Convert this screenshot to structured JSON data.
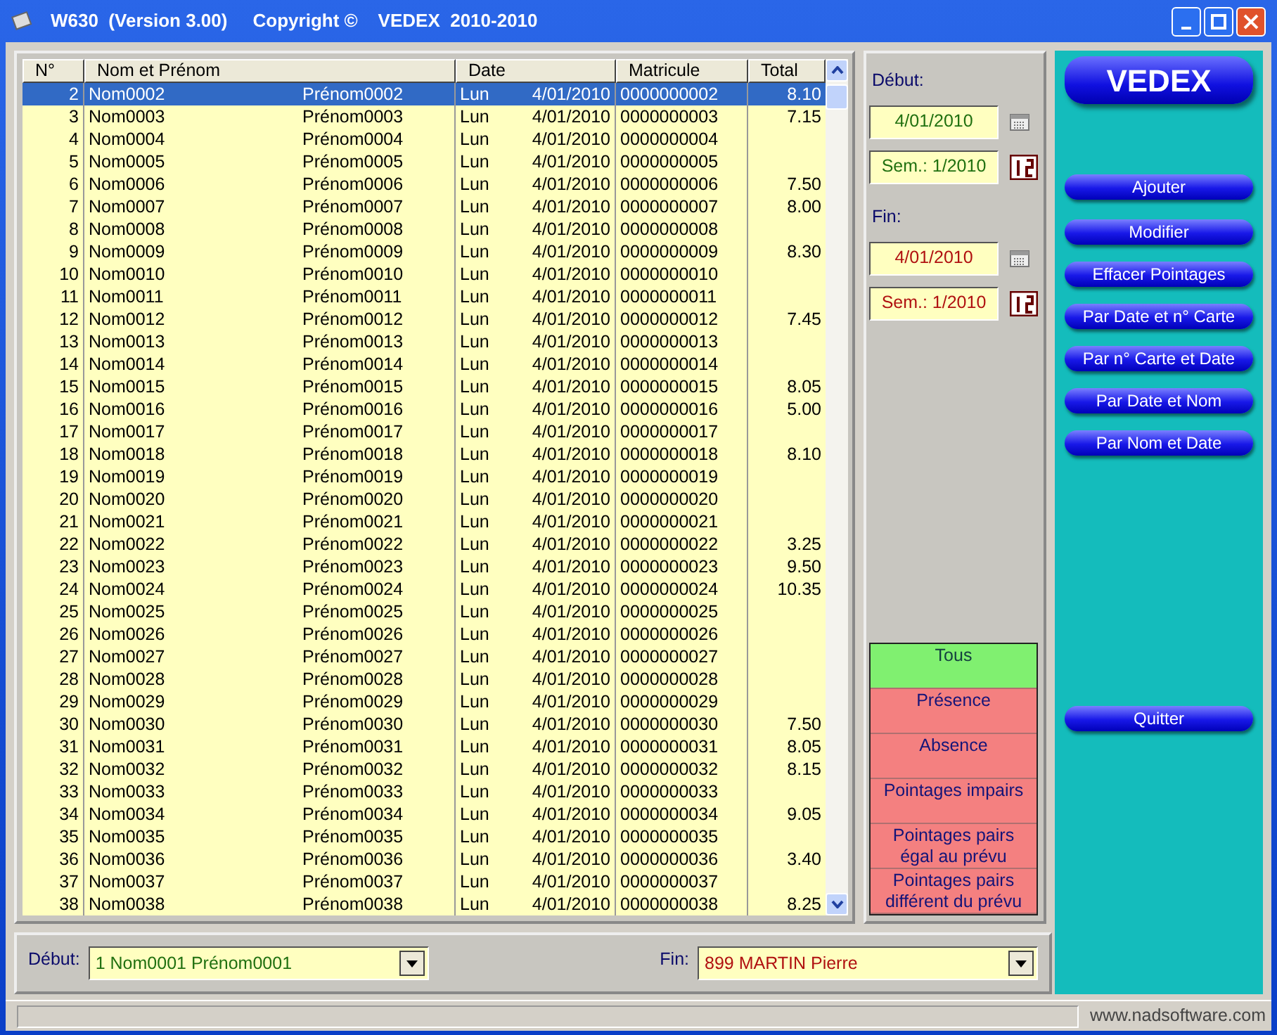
{
  "window": {
    "title": "W630  (Version 3.00)     Copyright ©    VEDEX  2010-2010"
  },
  "table": {
    "columns": [
      "N°",
      "Nom et Prénom",
      "Date",
      "Matricule",
      "Total"
    ],
    "rows": [
      {
        "n": "2",
        "nom": "Nom0002",
        "prenom": "Prénom0002",
        "jour": "Lun",
        "date": "4/01/2010",
        "matricule": "0000000002",
        "total": "8.10",
        "selected": true
      },
      {
        "n": "3",
        "nom": "Nom0003",
        "prenom": "Prénom0003",
        "jour": "Lun",
        "date": "4/01/2010",
        "matricule": "0000000003",
        "total": "7.15",
        "selected": false
      },
      {
        "n": "4",
        "nom": "Nom0004",
        "prenom": "Prénom0004",
        "jour": "Lun",
        "date": "4/01/2010",
        "matricule": "0000000004",
        "selected": false
      },
      {
        "n": "5",
        "nom": "Nom0005",
        "prenom": "Prénom0005",
        "jour": "Lun",
        "date": "4/01/2010",
        "matricule": "0000000005",
        "selected": false
      },
      {
        "n": "6",
        "nom": "Nom0006",
        "prenom": "Prénom0006",
        "jour": "Lun",
        "date": "4/01/2010",
        "matricule": "0000000006",
        "total": "7.50",
        "selected": false
      },
      {
        "n": "7",
        "nom": "Nom0007",
        "prenom": "Prénom0007",
        "jour": "Lun",
        "date": "4/01/2010",
        "matricule": "0000000007",
        "total": "8.00",
        "selected": false
      },
      {
        "n": "8",
        "nom": "Nom0008",
        "prenom": "Prénom0008",
        "jour": "Lun",
        "date": "4/01/2010",
        "matricule": "0000000008",
        "selected": false
      },
      {
        "n": "9",
        "nom": "Nom0009",
        "prenom": "Prénom0009",
        "jour": "Lun",
        "date": "4/01/2010",
        "matricule": "0000000009",
        "total": "8.30",
        "selected": false
      },
      {
        "n": "10",
        "nom": "Nom0010",
        "prenom": "Prénom0010",
        "jour": "Lun",
        "date": "4/01/2010",
        "matricule": "0000000010",
        "selected": false
      },
      {
        "n": "11",
        "nom": "Nom0011",
        "prenom": "Prénom0011",
        "jour": "Lun",
        "date": "4/01/2010",
        "matricule": "0000000011",
        "selected": false
      },
      {
        "n": "12",
        "nom": "Nom0012",
        "prenom": "Prénom0012",
        "jour": "Lun",
        "date": "4/01/2010",
        "matricule": "0000000012",
        "total": "7.45",
        "selected": false
      },
      {
        "n": "13",
        "nom": "Nom0013",
        "prenom": "Prénom0013",
        "jour": "Lun",
        "date": "4/01/2010",
        "matricule": "0000000013",
        "selected": false
      },
      {
        "n": "14",
        "nom": "Nom0014",
        "prenom": "Prénom0014",
        "jour": "Lun",
        "date": "4/01/2010",
        "matricule": "0000000014",
        "selected": false
      },
      {
        "n": "15",
        "nom": "Nom0015",
        "prenom": "Prénom0015",
        "jour": "Lun",
        "date": "4/01/2010",
        "matricule": "0000000015",
        "total": "8.05",
        "selected": false
      },
      {
        "n": "16",
        "nom": "Nom0016",
        "prenom": "Prénom0016",
        "jour": "Lun",
        "date": "4/01/2010",
        "matricule": "0000000016",
        "total": "5.00",
        "selected": false
      },
      {
        "n": "17",
        "nom": "Nom0017",
        "prenom": "Prénom0017",
        "jour": "Lun",
        "date": "4/01/2010",
        "matricule": "0000000017",
        "selected": false
      },
      {
        "n": "18",
        "nom": "Nom0018",
        "prenom": "Prénom0018",
        "jour": "Lun",
        "date": "4/01/2010",
        "matricule": "0000000018",
        "total": "8.10",
        "selected": false
      },
      {
        "n": "19",
        "nom": "Nom0019",
        "prenom": "Prénom0019",
        "jour": "Lun",
        "date": "4/01/2010",
        "matricule": "0000000019",
        "selected": false
      },
      {
        "n": "20",
        "nom": "Nom0020",
        "prenom": "Prénom0020",
        "jour": "Lun",
        "date": "4/01/2010",
        "matricule": "0000000020",
        "selected": false
      },
      {
        "n": "21",
        "nom": "Nom0021",
        "prenom": "Prénom0021",
        "jour": "Lun",
        "date": "4/01/2010",
        "matricule": "0000000021",
        "selected": false
      },
      {
        "n": "22",
        "nom": "Nom0022",
        "prenom": "Prénom0022",
        "jour": "Lun",
        "date": "4/01/2010",
        "matricule": "0000000022",
        "total": "3.25",
        "selected": false
      },
      {
        "n": "23",
        "nom": "Nom0023",
        "prenom": "Prénom0023",
        "jour": "Lun",
        "date": "4/01/2010",
        "matricule": "0000000023",
        "total": "9.50",
        "selected": false
      },
      {
        "n": "24",
        "nom": "Nom0024",
        "prenom": "Prénom0024",
        "jour": "Lun",
        "date": "4/01/2010",
        "matricule": "0000000024",
        "total": "10.35",
        "selected": false
      },
      {
        "n": "25",
        "nom": "Nom0025",
        "prenom": "Prénom0025",
        "jour": "Lun",
        "date": "4/01/2010",
        "matricule": "0000000025",
        "selected": false
      },
      {
        "n": "26",
        "nom": "Nom0026",
        "prenom": "Prénom0026",
        "jour": "Lun",
        "date": "4/01/2010",
        "matricule": "0000000026",
        "selected": false
      },
      {
        "n": "27",
        "nom": "Nom0027",
        "prenom": "Prénom0027",
        "jour": "Lun",
        "date": "4/01/2010",
        "matricule": "0000000027",
        "selected": false
      },
      {
        "n": "28",
        "nom": "Nom0028",
        "prenom": "Prénom0028",
        "jour": "Lun",
        "date": "4/01/2010",
        "matricule": "0000000028",
        "selected": false
      },
      {
        "n": "29",
        "nom": "Nom0029",
        "prenom": "Prénom0029",
        "jour": "Lun",
        "date": "4/01/2010",
        "matricule": "0000000029",
        "selected": false
      },
      {
        "n": "30",
        "nom": "Nom0030",
        "prenom": "Prénom0030",
        "jour": "Lun",
        "date": "4/01/2010",
        "matricule": "0000000030",
        "total": "7.50",
        "selected": false
      },
      {
        "n": "31",
        "nom": "Nom0031",
        "prenom": "Prénom0031",
        "jour": "Lun",
        "date": "4/01/2010",
        "matricule": "0000000031",
        "total": "8.05",
        "selected": false
      },
      {
        "n": "32",
        "nom": "Nom0032",
        "prenom": "Prénom0032",
        "jour": "Lun",
        "date": "4/01/2010",
        "matricule": "0000000032",
        "total": "8.15",
        "selected": false
      },
      {
        "n": "33",
        "nom": "Nom0033",
        "prenom": "Prénom0033",
        "jour": "Lun",
        "date": "4/01/2010",
        "matricule": "0000000033",
        "selected": false
      },
      {
        "n": "34",
        "nom": "Nom0034",
        "prenom": "Prénom0034",
        "jour": "Lun",
        "date": "4/01/2010",
        "matricule": "0000000034",
        "total": "9.05",
        "selected": false
      },
      {
        "n": "35",
        "nom": "Nom0035",
        "prenom": "Prénom0035",
        "jour": "Lun",
        "date": "4/01/2010",
        "matricule": "0000000035",
        "selected": false
      },
      {
        "n": "36",
        "nom": "Nom0036",
        "prenom": "Prénom0036",
        "jour": "Lun",
        "date": "4/01/2010",
        "matricule": "0000000036",
        "total": "3.40",
        "selected": false
      },
      {
        "n": "37",
        "nom": "Nom0037",
        "prenom": "Prénom0037",
        "jour": "Lun",
        "date": "4/01/2010",
        "matricule": "0000000037",
        "selected": false
      },
      {
        "n": "38",
        "nom": "Nom0038",
        "prenom": "Prénom0038",
        "jour": "Lun",
        "date": "4/01/2010",
        "matricule": "0000000038",
        "total": "8.25",
        "selected": false
      }
    ]
  },
  "period": {
    "start_label": "Début:",
    "start_date": "4/01/2010",
    "start_week": "Sem.: 1/2010",
    "end_label": "Fin:",
    "end_date": "4/01/2010",
    "end_week": "Sem.: 1/2010"
  },
  "filters": [
    {
      "label": "Tous",
      "selected": true
    },
    {
      "label": "Présence",
      "selected": false
    },
    {
      "label": "Absence",
      "selected": false
    },
    {
      "label": "Pointages impairs",
      "selected": false
    },
    {
      "label": "Pointages pairs égal au prévu",
      "selected": false
    },
    {
      "label": "Pointages pairs différent du prévu",
      "selected": false
    }
  ],
  "range": {
    "start_label": "Début:",
    "start_value": "1 Nom0001 Prénom0001",
    "end_label": "Fin:",
    "end_value": "899 MARTIN Pierre"
  },
  "sidebar": {
    "logo": "VEDEX",
    "buttons": [
      "Ajouter",
      "Modifier",
      "Effacer Pointages",
      "Par Date et n° Carte",
      "Par n° Carte et Date",
      "Par Date et Nom",
      "Par Nom et Date"
    ],
    "quit": "Quitter"
  },
  "status_bar": {
    "url": "www.nadsoftware.com"
  }
}
